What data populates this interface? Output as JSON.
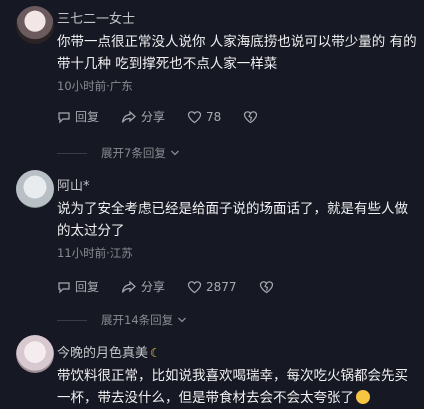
{
  "comments": [
    {
      "user": "三七二一女士",
      "text": "你带一点很正常没人说你 人家海底捞也说可以带少量的 有的带十几种 吃到撑死也不点人家一样菜",
      "meta": "10小时前·广东",
      "reply_label": "回复",
      "share_label": "分享",
      "likes": "78",
      "expand": "展开7条回复"
    },
    {
      "user": "阿山*",
      "text": "说为了安全考虑已经是给面子说的场面话了，就是有些人做的太过分了",
      "meta": "11小时前·江苏",
      "reply_label": "回复",
      "share_label": "分享",
      "likes": "2877",
      "expand": "展开14条回复"
    },
    {
      "user": "今晚的月色真美",
      "user_emoji": "moon-emoji",
      "text": "带饮料很正常，比如说我喜欢喝瑞幸，每次吃火锅都会先买一杯，带去没什么，但是带食材去会不会太夸张了",
      "text_emoji": "laughing-emoji"
    }
  ]
}
